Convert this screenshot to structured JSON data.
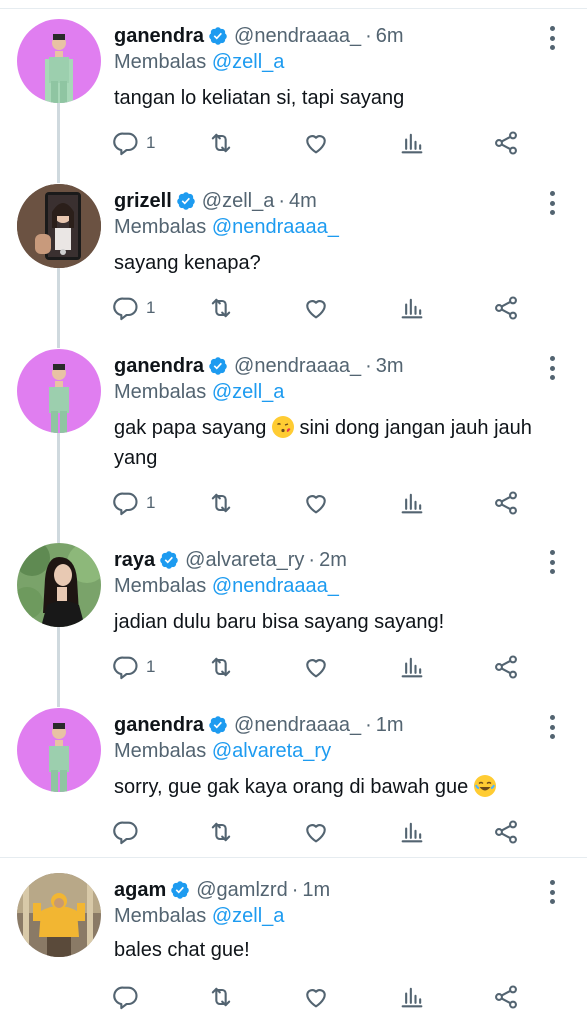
{
  "colors": {
    "link": "#1d9bf0",
    "secondary": "#536471",
    "verified": "#1d9bf0"
  },
  "reply_prefix": "Membalas",
  "tweets": [
    {
      "name": "ganendra",
      "handle": "@nendraaaa_",
      "time": "6m",
      "reply_to": "@zell_a",
      "text": "tangan lo keliatan si, tapi sayang",
      "reply_count": "1",
      "avatar": "ganendra-avatar"
    },
    {
      "name": "grizell",
      "handle": "@zell_a",
      "time": "4m",
      "reply_to": "@nendraaaa_",
      "text": "sayang kenapa?",
      "reply_count": "1",
      "avatar": "grizell-avatar"
    },
    {
      "name": "ganendra",
      "handle": "@nendraaaa_",
      "time": "3m",
      "reply_to": "@zell_a",
      "text_before": "gak papa sayang ",
      "text_emoji": "😘",
      "text_after": " sini dong jangan jauh jauh yang",
      "reply_count": "1",
      "avatar": "ganendra-avatar"
    },
    {
      "name": "raya",
      "handle": "@alvareta_ry",
      "time": "2m",
      "reply_to": "@nendraaaa_",
      "text": "jadian dulu baru bisa sayang sayang!",
      "reply_count": "1",
      "avatar": "raya-avatar"
    },
    {
      "name": "ganendra",
      "handle": "@nendraaaa_",
      "time": "1m",
      "reply_to": "@alvareta_ry",
      "text_before": "sorry, gue gak kaya orang di bawah gue ",
      "text_emoji": "😂",
      "reply_count": "",
      "avatar": "ganendra-avatar"
    },
    {
      "name": "agam",
      "handle": "@gamlzrd",
      "time": "1m",
      "reply_to": "@zell_a",
      "text": "bales chat gue!",
      "reply_count": "",
      "avatar": "agam-avatar"
    }
  ]
}
